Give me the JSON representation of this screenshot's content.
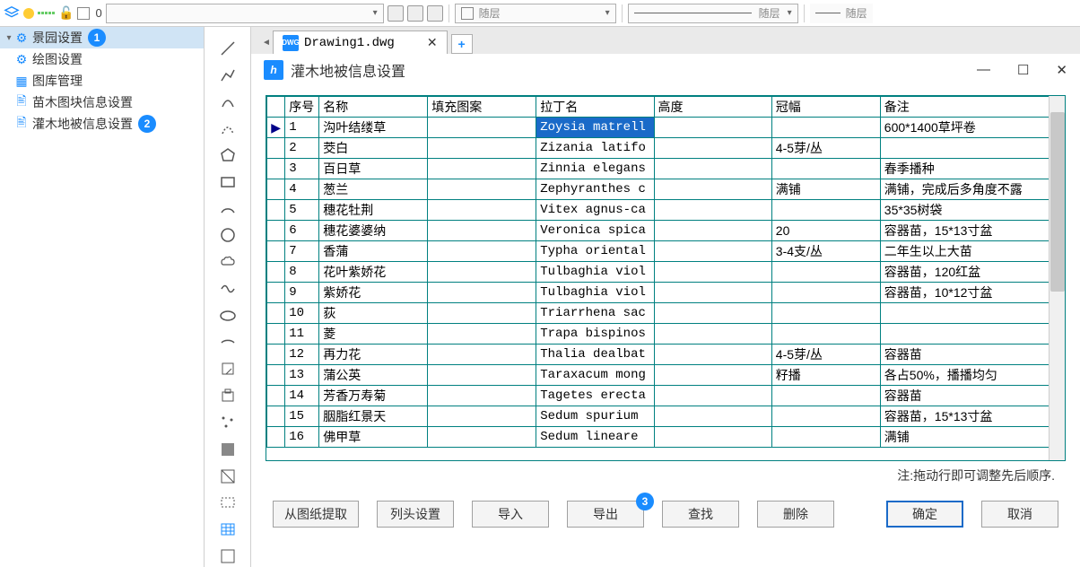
{
  "toolbar": {
    "layer_default": "随层",
    "num": "0"
  },
  "sidebar": {
    "items": [
      {
        "label": "景园设置",
        "badge": "1"
      },
      {
        "label": "绘图设置"
      },
      {
        "label": "图库管理"
      },
      {
        "label": "苗木图块信息设置"
      },
      {
        "label": "灌木地被信息设置",
        "badge": "2"
      }
    ]
  },
  "filetab": {
    "name": "Drawing1.dwg"
  },
  "dialog": {
    "title": "灌木地被信息设置",
    "note": "注:拖动行即可调整先后顺序.",
    "headers": [
      "序号",
      "名称",
      "填充图案",
      "拉丁名",
      "高度",
      "冠幅",
      "备注"
    ],
    "rows": [
      {
        "i": "1",
        "name": "沟叶结缕草",
        "fill": "",
        "latin": "Zoysia matrell",
        "h": "",
        "crown": "",
        "note": "600*1400草坪卷",
        "mark": "▶",
        "sel": true
      },
      {
        "i": "2",
        "name": "茭白",
        "fill": "",
        "latin": "Zizania latifo",
        "h": "",
        "crown": "4-5芽/丛",
        "note": ""
      },
      {
        "i": "3",
        "name": "百日草",
        "fill": "",
        "latin": "Zinnia elegans",
        "h": "",
        "crown": "",
        "note": "春季播种"
      },
      {
        "i": "4",
        "name": "葱兰",
        "fill": "",
        "latin": "Zephyranthes c",
        "h": "",
        "crown": "满铺",
        "note": "满铺，完成后多角度不露"
      },
      {
        "i": "5",
        "name": "穗花牡荆",
        "fill": "",
        "latin": "Vitex agnus-ca",
        "h": "",
        "crown": "",
        "note": "35*35树袋"
      },
      {
        "i": "6",
        "name": "穗花婆婆纳",
        "fill": "",
        "latin": "Veronica spica",
        "h": "",
        "crown": "20",
        "note": "容器苗，15*13寸盆"
      },
      {
        "i": "7",
        "name": "香蒲",
        "fill": "",
        "latin": "Typha oriental",
        "h": "",
        "crown": "3-4支/丛",
        "note": "二年生以上大苗"
      },
      {
        "i": "8",
        "name": "花叶紫娇花",
        "fill": "",
        "latin": "Tulbaghia viol",
        "h": "",
        "crown": "",
        "note": "容器苗，120红盆"
      },
      {
        "i": "9",
        "name": "紫娇花",
        "fill": "",
        "latin": "Tulbaghia viol",
        "h": "",
        "crown": "",
        "note": "容器苗，10*12寸盆"
      },
      {
        "i": "10",
        "name": "荻",
        "fill": "",
        "latin": "Triarrhena sac",
        "h": "",
        "crown": "",
        "note": ""
      },
      {
        "i": "11",
        "name": "菱",
        "fill": "",
        "latin": "Trapa bispinos",
        "h": "",
        "crown": "",
        "note": ""
      },
      {
        "i": "12",
        "name": "再力花",
        "fill": "",
        "latin": "Thalia dealbat",
        "h": "",
        "crown": "4-5芽/丛",
        "note": "容器苗"
      },
      {
        "i": "13",
        "name": "蒲公英",
        "fill": "",
        "latin": "Taraxacum mong",
        "h": "",
        "crown": "籽播",
        "note": "各占50%，播播均匀"
      },
      {
        "i": "14",
        "name": "芳香万寿菊",
        "fill": "",
        "latin": "Tagetes erecta",
        "h": "",
        "crown": "",
        "note": "容器苗"
      },
      {
        "i": "15",
        "name": "胭脂红景天",
        "fill": "",
        "latin": "Sedum spurium",
        "h": "",
        "crown": "",
        "note": "容器苗，15*13寸盆"
      },
      {
        "i": "16",
        "name": "佛甲草",
        "fill": "",
        "latin": "Sedum lineare",
        "h": "",
        "crown": "",
        "note": "满铺"
      }
    ],
    "buttons": {
      "extract": "从图纸提取",
      "colset": "列头设置",
      "import": "导入",
      "export": "导出",
      "export_badge": "3",
      "find": "查找",
      "delete": "删除",
      "ok": "确定",
      "cancel": "取消"
    }
  }
}
